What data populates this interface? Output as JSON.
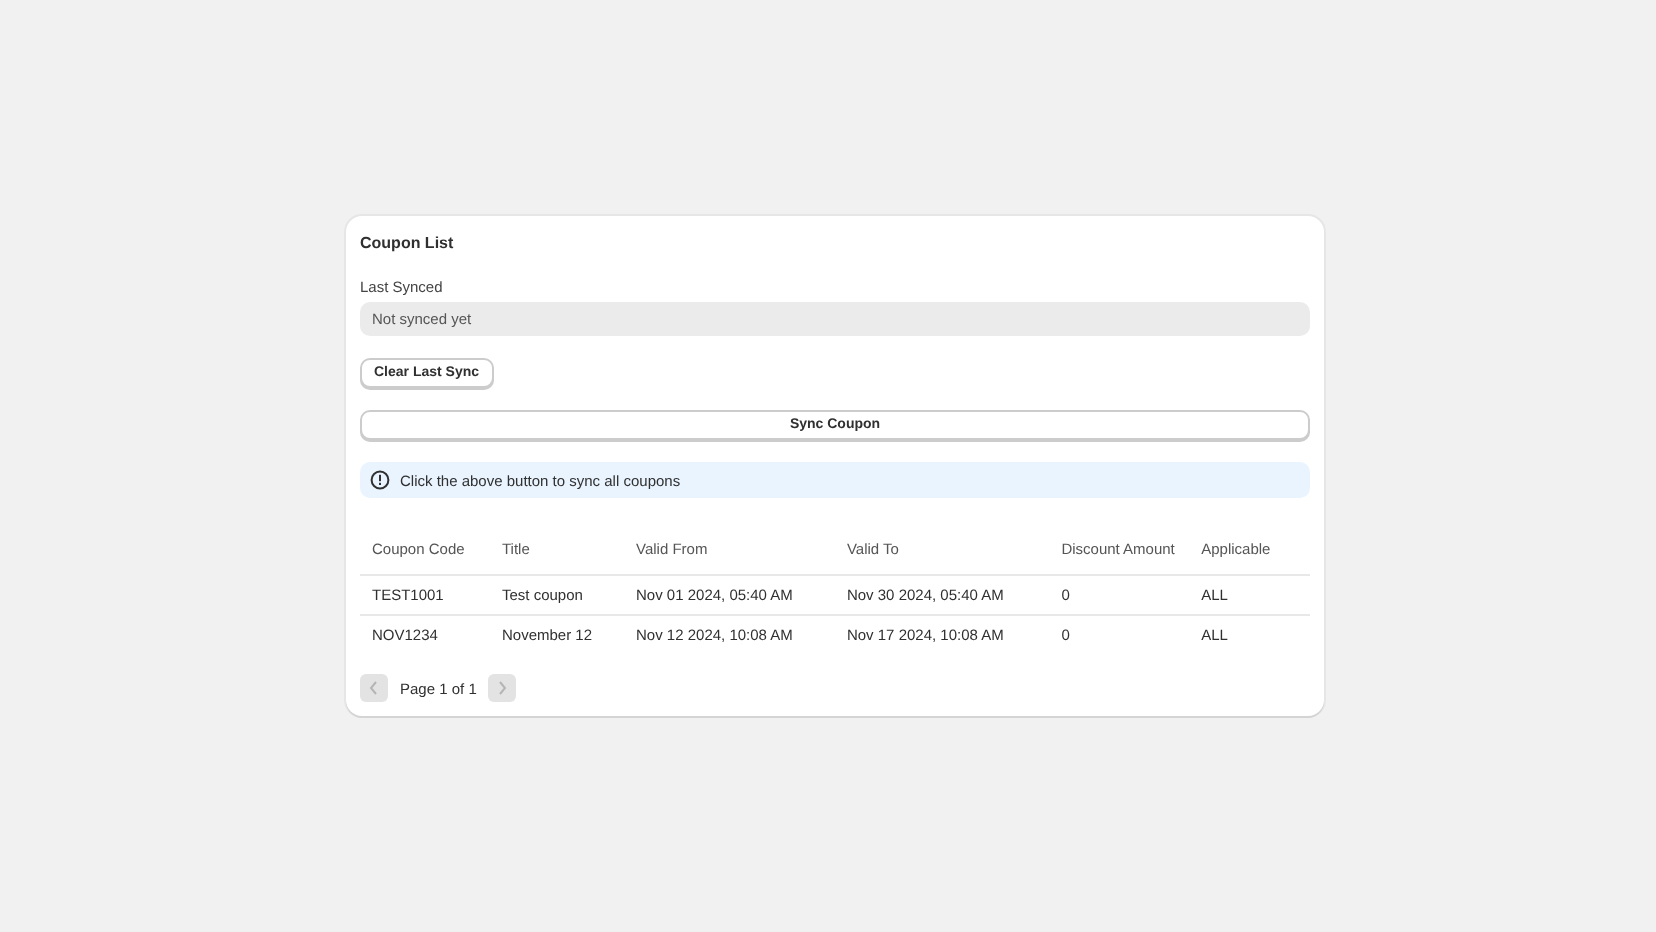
{
  "card": {
    "title": "Coupon List"
  },
  "last_synced": {
    "label": "Last Synced",
    "value": "Not synced yet"
  },
  "clear_button": "Clear Last Sync",
  "sync_button": "Sync Coupon",
  "info_banner": "Click the above button to sync all coupons",
  "table": {
    "columns": [
      "Coupon Code",
      "Title",
      "Valid From",
      "Valid To",
      "Discount Amount",
      "Applicable"
    ],
    "rows": [
      [
        "TEST1001",
        "Test coupon",
        "Nov 01 2024, 05:40 AM",
        "Nov 30 2024, 05:40 AM",
        "0",
        "ALL"
      ],
      [
        "NOV1234",
        "November 12",
        "Nov 12 2024, 10:08 AM",
        "Nov 17 2024, 10:08 AM",
        "0",
        "ALL"
      ]
    ]
  },
  "pagination": {
    "label": "Page 1 of 1",
    "prev_disabled": true,
    "next_disabled": true
  }
}
